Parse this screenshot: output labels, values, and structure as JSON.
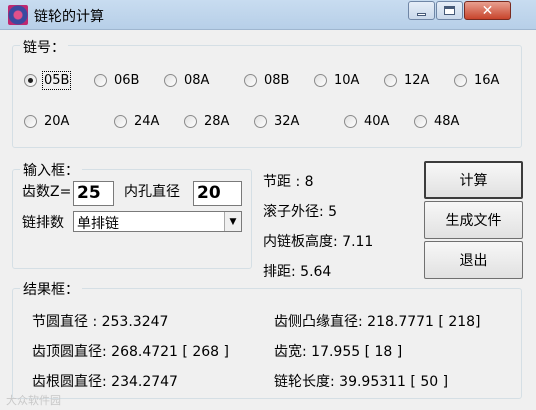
{
  "window": {
    "title": "链轮的计算",
    "close_glyph": "✕"
  },
  "chain_no": {
    "legend": "链号：",
    "options": [
      "05B",
      "06B",
      "08A",
      "08B",
      "10A",
      "12A",
      "16A",
      "20A",
      "24A",
      "28A",
      "32A",
      "40A",
      "48A"
    ],
    "selected": "05B"
  },
  "input_box": {
    "legend": "输入框：",
    "teeth_label": "齿数Z=",
    "teeth_value": "25",
    "bore_label": "内孔直径",
    "bore_value": "20",
    "rows_label": "链排数",
    "rows_value": "单排链",
    "dropdown_arrow": "▼"
  },
  "params": {
    "pitch": "节距   :   8",
    "roller_dia": "滚子外径:   5",
    "inner_plate_height": "内链板高度:  7.11",
    "row_spacing": "排距:   5.64"
  },
  "buttons": {
    "calculate": "计算",
    "generate_file": "生成文件",
    "exit": "退出"
  },
  "results": {
    "legend": "结果框：",
    "pitch_circle_dia": "节圆直径  :  253.3247",
    "flange_dia": "齿侧凸缘直径:  218.7771  [ 218]",
    "tip_circle_dia": "齿顶圆直径:  268.4721  [ 268 ]",
    "tooth_width": "齿宽:  17.955  [ 18 ]",
    "root_circle_dia": "齿根圆直径:  234.2747",
    "hub_length": "链轮长度:  39.95311   [ 50 ]"
  },
  "watermark": "大众软件园"
}
